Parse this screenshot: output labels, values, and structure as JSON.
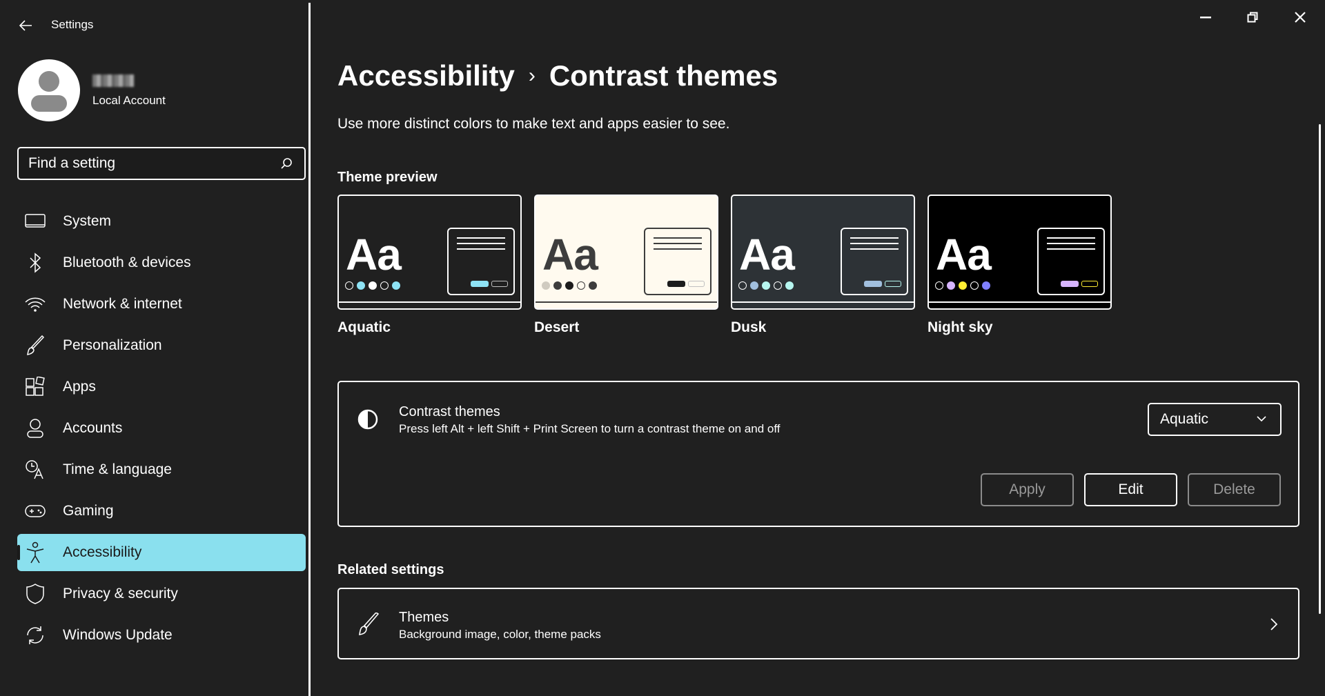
{
  "app": {
    "title": "Settings"
  },
  "profile": {
    "name": "",
    "account_type": "Local Account"
  },
  "search": {
    "placeholder": "Find a setting",
    "value": ""
  },
  "sidebar": {
    "items": [
      {
        "label": "System",
        "icon": "monitor-icon"
      },
      {
        "label": "Bluetooth & devices",
        "icon": "bluetooth-icon"
      },
      {
        "label": "Network & internet",
        "icon": "wifi-icon"
      },
      {
        "label": "Personalization",
        "icon": "brush-icon"
      },
      {
        "label": "Apps",
        "icon": "apps-icon"
      },
      {
        "label": "Accounts",
        "icon": "person-icon"
      },
      {
        "label": "Time & language",
        "icon": "time-language-icon"
      },
      {
        "label": "Gaming",
        "icon": "gamepad-icon"
      },
      {
        "label": "Accessibility",
        "icon": "accessibility-icon",
        "selected": true
      },
      {
        "label": "Privacy & security",
        "icon": "shield-icon"
      },
      {
        "label": "Windows Update",
        "icon": "update-icon"
      }
    ]
  },
  "header": {
    "breadcrumb_parent": "Accessibility",
    "breadcrumb_separator": "›",
    "breadcrumb_current": "Contrast themes",
    "description": "Use more distinct colors to make text and apps easier to see."
  },
  "theme_preview": {
    "title": "Theme preview",
    "sample_text": "Aa",
    "themes": [
      {
        "name": "Aquatic",
        "bg": "#202020",
        "fg": "#ffffff",
        "dots": [
          "#202020",
          "#8ee3f5",
          "#ffffff",
          "#202020",
          "#8ee3f5"
        ],
        "accent": "#8ee3f5",
        "accent2": "#c0c0c0"
      },
      {
        "name": "Desert",
        "bg": "#fffaef",
        "fg": "#3d3d3d",
        "dots": [
          "#d0cbc0",
          "#3d3d3d",
          "#1c1c1c",
          "#fffaef",
          "#3d3d3d"
        ],
        "accent": "#1c1c1c",
        "accent2": "#c0c0c0"
      },
      {
        "name": "Dusk",
        "bg": "#2d3236",
        "fg": "#ffffff",
        "dots": [
          "#2d3236",
          "#a1bfde",
          "#b6f6f0",
          "#2d3236",
          "#b6f6f0"
        ],
        "accent": "#a1bfde",
        "accent2": "#b6f6f0"
      },
      {
        "name": "Night sky",
        "bg": "#000000",
        "fg": "#ffffff",
        "dots": [
          "#000000",
          "#d6b4fd",
          "#ffee32",
          "#000000",
          "#8080ff"
        ],
        "accent": "#d6b4fd",
        "accent2": "#ffee32"
      }
    ]
  },
  "contrast_card": {
    "title": "Contrast themes",
    "subtitle": "Press left Alt + left Shift + Print Screen to turn a contrast theme on and off",
    "selected_theme": "Aquatic",
    "apply_label": "Apply",
    "edit_label": "Edit",
    "delete_label": "Delete"
  },
  "related": {
    "title": "Related settings",
    "themes_title": "Themes",
    "themes_subtitle": "Background image, color, theme packs"
  },
  "colors": {
    "background": "#202020",
    "accent": "#8ae0ee",
    "text": "#ffffff",
    "disabled": "#9a9a9a"
  }
}
